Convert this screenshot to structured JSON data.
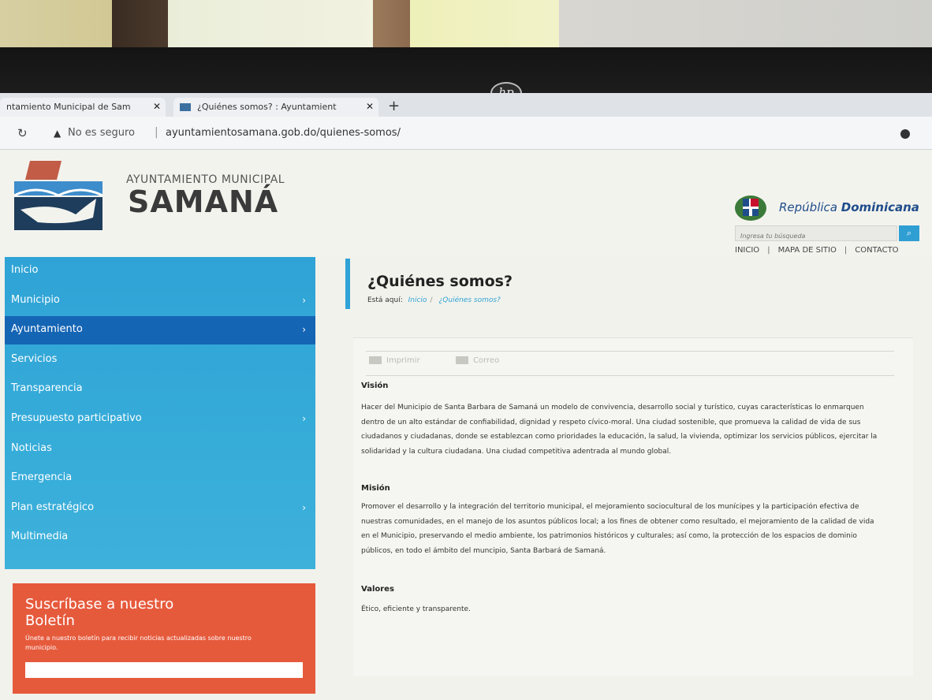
{
  "browser": {
    "tabs": [
      {
        "label": "ntamiento Municipal de Sam"
      },
      {
        "label": "¿Quiénes somos? : Ayuntamient"
      }
    ],
    "not_secure": "No es seguro",
    "url": "ayuntamientosamana.gob.do/quienes-somos/"
  },
  "header": {
    "org_line": "AYUNTAMIENTO MUNICIPAL",
    "org_name": "SAMANÁ",
    "rd_label_plain": "República ",
    "rd_label_bold": "Dominicana",
    "search_placeholder": "Ingresa tu búsqueda",
    "top_links": [
      "INICIO",
      "MAPA DE SITIO",
      "CONTACTO"
    ],
    "link_separator": "|"
  },
  "sidebar": {
    "items": [
      {
        "label": "Inicio",
        "chevron": false,
        "active": false
      },
      {
        "label": "Municipio",
        "chevron": true,
        "active": false
      },
      {
        "label": "Ayuntamiento",
        "chevron": true,
        "active": true
      },
      {
        "label": "Servicios",
        "chevron": false,
        "active": false
      },
      {
        "label": "Transparencia",
        "chevron": false,
        "active": false
      },
      {
        "label": "Presupuesto participativo",
        "chevron": true,
        "active": false
      },
      {
        "label": "Noticias",
        "chevron": false,
        "active": false
      },
      {
        "label": "Emergencia",
        "chevron": false,
        "active": false
      },
      {
        "label": "Plan estratégico",
        "chevron": true,
        "active": false
      },
      {
        "label": "Multimedia",
        "chevron": false,
        "active": false
      }
    ],
    "chevron_glyph": "›"
  },
  "newsletter": {
    "title": "Suscríbase a nuestro Boletín",
    "text": "Únete a nuestro boletín para recibir noticias actualizadas sobre nuestro municipio."
  },
  "main": {
    "title": "¿Quiénes somos?",
    "breadcrumb_label": "Está aquí:",
    "breadcrumb": [
      "Inicio",
      "¿Quiénes somos?"
    ],
    "breadcrumb_sep": "/",
    "print_label": "Imprimir",
    "email_label": "Correo",
    "sections": [
      {
        "heading": "Visión",
        "text": "Hacer del Municipio de Santa Barbara de Samaná un modelo de convivencia, desarrollo social y turístico, cuyas características lo enmarquen dentro de un alto estándar de confiabilidad, dignidad y respeto cívico-moral. Una ciudad sostenible, que promueva la calidad de vida de sus ciudadanos y ciudadanas, donde se establezcan como prioridades la educación, la salud, la vivienda, optimizar los servicios públicos, ejercitar la solidaridad y la cultura ciudadana. Una ciudad competitiva adentrada al mundo global."
      },
      {
        "heading": "Misión",
        "text": "Promover el desarrollo y la integración del territorio municipal, el mejoramiento sociocultural de los munícipes y la participación efectiva de nuestras comunidades, en el manejo de los asuntos públicos local; a los fines de obtener como resultado, el mejoramiento de la calidad de vida en el Municipio, preservando el medio ambiente, los patrimonios históricos y culturales; así como, la protección de los espacios de dominio públicos, en todo el ámbito del muncipio, Santa Barbará de Samaná."
      },
      {
        "heading": "Valores",
        "text": "Ético, eficiente y transparente."
      }
    ]
  },
  "colors": {
    "sidebar": "#2fa3d6",
    "sidebar_active": "#1565b5",
    "newsletter": "#e65a3c",
    "accent": "#2fa3d6"
  }
}
